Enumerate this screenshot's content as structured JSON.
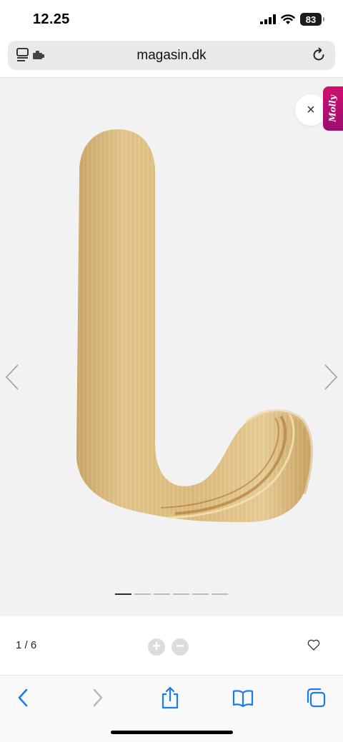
{
  "status_bar": {
    "time": "12.25",
    "battery": "83",
    "icons": [
      "cellular-signal-icon",
      "wifi-icon",
      "battery-icon"
    ]
  },
  "browser": {
    "url": "magasin.dk",
    "left_icon": "reader-extension-icon",
    "right_icon": "reload-icon"
  },
  "gallery": {
    "close_label": "×",
    "chat_widget_label": "Molly",
    "current_index": 1,
    "total": 6,
    "colors": {
      "background": "#f2f2f2",
      "wood_light": "#e3c98e",
      "wood_dark": "#c49a52",
      "molly_pink": "#c80f70"
    }
  },
  "info": {
    "counter": "1 / 6",
    "zoom_in_label": "+",
    "zoom_out_label": "−",
    "favorite_icon": "heart-icon"
  },
  "toolbar": {
    "accent": "#1a7cf5",
    "items": [
      "back-icon",
      "forward-icon",
      "share-icon",
      "bookmarks-icon",
      "tabs-icon"
    ]
  }
}
